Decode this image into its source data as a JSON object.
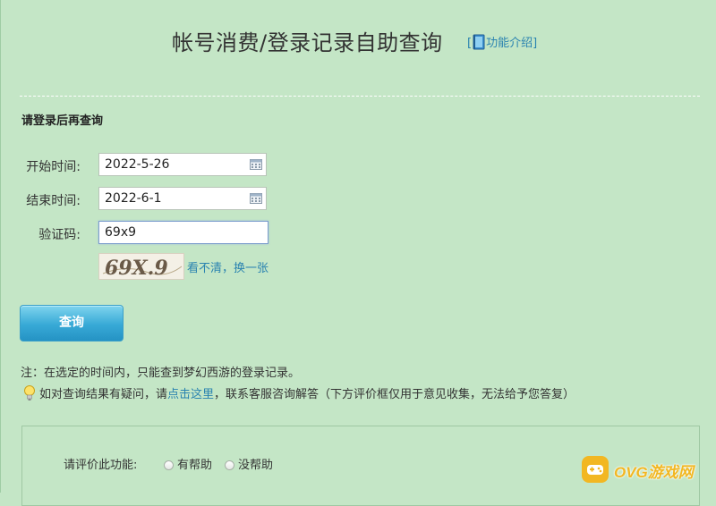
{
  "header": {
    "title": "帐号消费/登录记录自助查询",
    "help_link": "功能介绍"
  },
  "section": {
    "login_prompt": "请登录后再查询"
  },
  "form": {
    "start_label": "开始时间:",
    "start_value": "2022-5-26",
    "end_label": "结束时间:",
    "end_value": "2022-6-1",
    "captcha_label": "验证码:",
    "captcha_value": "69x9",
    "captcha_image_text": "69X.9",
    "refresh_link": "看不清，换一张",
    "query_button": "查询"
  },
  "notes": {
    "note": "注：在选定的时间内，只能查到梦幻西游的登录记录。",
    "tip_before": "如对查询结果有疑问，请",
    "tip_link": "点击这里",
    "tip_after": "，联系客服咨询解答（下方评价框仅用于意见收集，无法给予您答复）"
  },
  "rating": {
    "label": "请评价此功能:",
    "option_helpful": "有帮助",
    "option_not_helpful": "没帮助"
  },
  "watermark": {
    "text": "OVG游戏网"
  },
  "colors": {
    "background": "#c4e6c6",
    "link": "#2a83b0",
    "button": "#37a9d6",
    "watermark": "#f2b722"
  },
  "icons": {
    "help": "book-icon",
    "date": "calendar-icon",
    "tip": "lightbulb-icon",
    "watermark": "gamepad-icon"
  }
}
